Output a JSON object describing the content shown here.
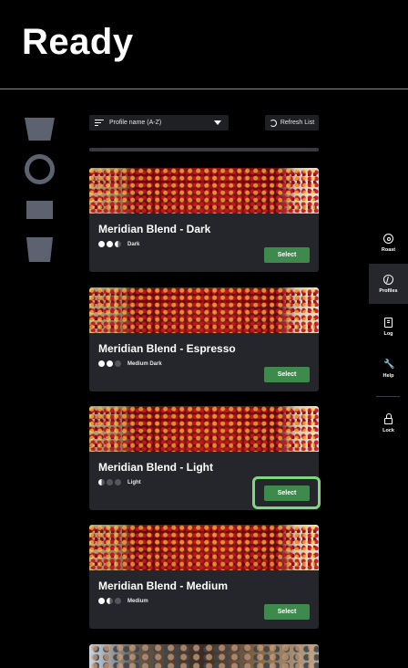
{
  "header": {
    "title": "Ready"
  },
  "toolbar": {
    "sort_label": "Profile name (A-Z)",
    "refresh_label": "Refresh List"
  },
  "profiles": [
    {
      "name": "Meridian Blend - Dark",
      "roast_label": "Dark",
      "roast_dots": [
        "full",
        "full",
        "half"
      ],
      "select_label": "Select",
      "image": "coffee-cherries"
    },
    {
      "name": "Meridian Blend - Espresso",
      "roast_label": "Medium Dark",
      "roast_dots": [
        "full",
        "full",
        "empty"
      ],
      "select_label": "Select",
      "image": "coffee-cherries"
    },
    {
      "name": "Meridian Blend - Light",
      "roast_label": "Light",
      "roast_dots": [
        "half",
        "empty",
        "empty"
      ],
      "select_label": "Select",
      "image": "coffee-cherries",
      "focused": true
    },
    {
      "name": "Meridian Blend - Medium",
      "roast_label": "Medium",
      "roast_dots": [
        "full",
        "half",
        "empty"
      ],
      "select_label": "Select",
      "image": "coffee-cherries"
    }
  ],
  "nav": {
    "items": [
      {
        "label": "Roast",
        "icon": "target-icon"
      },
      {
        "label": "Profiles",
        "icon": "bean-icon",
        "active": true
      },
      {
        "label": "Log",
        "icon": "log-icon"
      },
      {
        "label": "Help",
        "icon": "wrench-icon"
      },
      {
        "label": "Lock",
        "icon": "lock-icon"
      }
    ]
  },
  "colors": {
    "background": "#000000",
    "card": "#25262b",
    "select_button": "#3e8a4c",
    "focus_ring": "#7cd97e",
    "shape_gray": "#5c6270"
  }
}
